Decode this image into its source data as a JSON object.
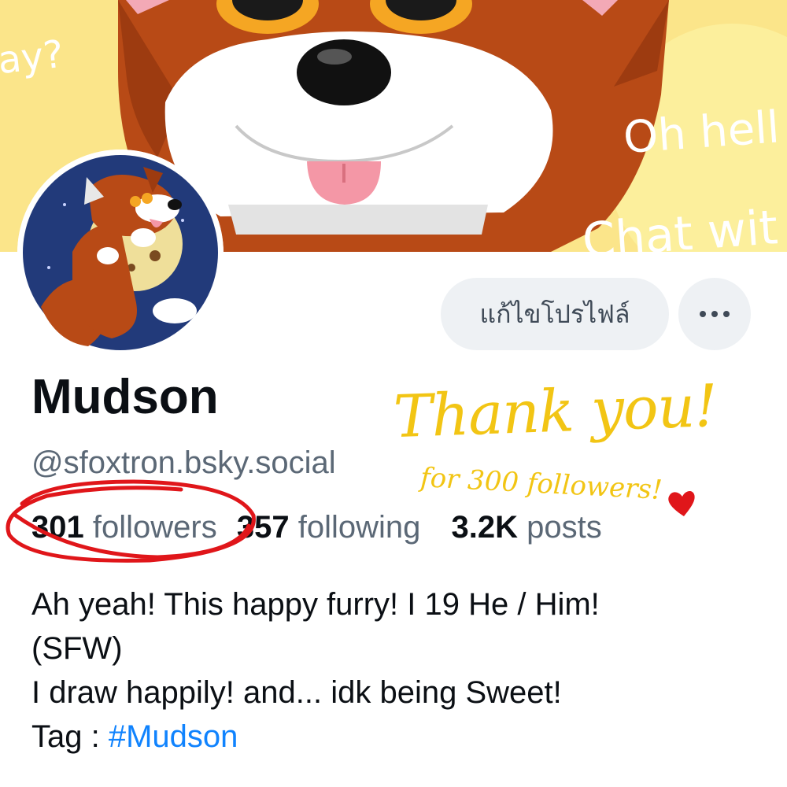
{
  "banner": {
    "text_left": "ay?",
    "text_hello": "Oh hell",
    "text_chat": "Chat wit"
  },
  "profile": {
    "edit_button_label": "แก้ไขโปรไฟล์",
    "display_name": "Mudson",
    "handle": "@sfoxtron.bsky.social",
    "stats": {
      "followers_count": "301",
      "followers_label": "followers",
      "following_count": "357",
      "following_label": "following",
      "posts_count": "3.2K",
      "posts_label": "posts"
    },
    "bio": {
      "line1": "Ah yeah! This happy furry! I 19 He / Him!",
      "line2": "(SFW)",
      "line3": "I draw happily! and... idk being Sweet!",
      "tag_prefix": "Tag : ",
      "hashtag": "#Mudson"
    }
  },
  "annotations": {
    "thanks_big": "Thank you!",
    "thanks_small": "for 300 followers!",
    "circle_color": "#e0161a",
    "heart_color": "#e0161a",
    "handwriting_color": "#f2c514"
  },
  "colors": {
    "text_primary": "#0b0f14",
    "text_secondary": "#5b6876",
    "link": "#1083fe",
    "button_bg": "#eef1f4"
  },
  "icons": {
    "more": "ellipsis-icon",
    "heart": "heart-icon"
  }
}
